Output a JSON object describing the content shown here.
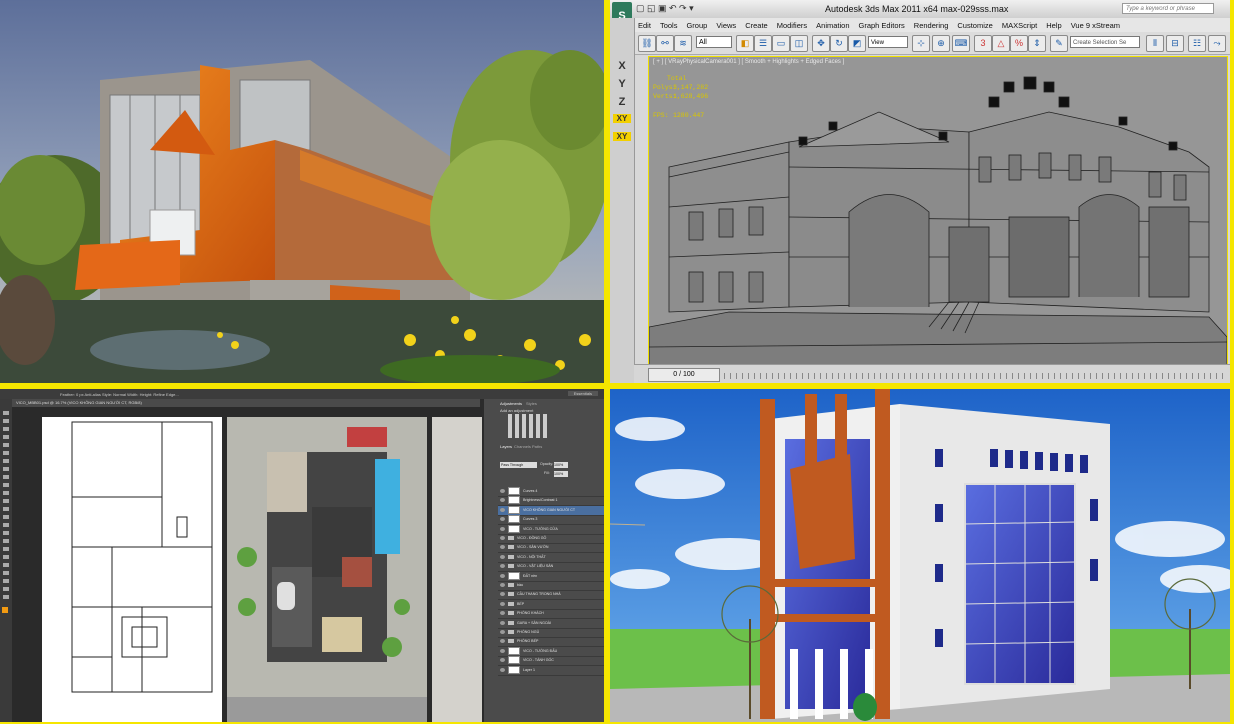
{
  "panel_render_orange": {},
  "max": {
    "window_title": "Autodesk 3ds Max  2011 x64    max-029sss.max",
    "search_placeholder": "Type a keyword or phrase",
    "menu": [
      "Edit",
      "Tools",
      "Group",
      "Views",
      "Create",
      "Modifiers",
      "Animation",
      "Graph Editors",
      "Rendering",
      "Customize",
      "MAXScript",
      "Help",
      "Vue 9 xStream"
    ],
    "selection_filter": "All",
    "ref_coord": "View",
    "named_selection": "Create Selection Se",
    "viewport_label": "[ + ] [ VRayPhysicalCamera001 ] [ Smooth + Highlights + Edged Faces ]",
    "stats": {
      "total_label": "Total",
      "polys_label": "Polys:",
      "polys": "3,147,282",
      "verts_label": "Verts:",
      "verts": "1,628,496",
      "fps_label": "FPS:",
      "fps": "1280.447"
    },
    "axis_labels": [
      "X",
      "Y",
      "Z",
      "XY",
      "XY"
    ],
    "timeline": "0 / 100"
  },
  "ps": {
    "options_bar": "Feather: 0 px   Anti-alias   Style: Normal   Width:   Height:   Refine Edge...",
    "workspace": "Essentials",
    "doc_tab": "VICO_MBB01.psd @ 16.7% (VICO KHÔNG GIAN NGƯỜI CT, RGB/8)",
    "adjustments_tab": "Adjustments",
    "styles_tab": "Styles",
    "add_adjustment": "Add an adjustment",
    "layers_tabs": [
      "Layers",
      "Channels",
      "Paths"
    ],
    "blend_mode": "Pass Through",
    "opacity_label": "Opacity:",
    "opacity": "100%",
    "fill_label": "Fill:",
    "fill": "100%",
    "layers": [
      {
        "name": "Curves 4",
        "type": "adj"
      },
      {
        "name": "Brightness/Contrast 1",
        "type": "adj"
      },
      {
        "name": "VICO KHÔNG GIAN NGƯỜI CT",
        "type": "adj",
        "selected": true
      },
      {
        "name": "Curves 3",
        "type": "adj"
      },
      {
        "name": "VICO - TƯỜNG CỬA",
        "type": "thumb"
      },
      {
        "name": "VICO - ĐỒNG GỖ",
        "type": "folder"
      },
      {
        "name": "VICO - SÂN VƯỜN",
        "type": "folder"
      },
      {
        "name": "VICO - NỘI THẤT",
        "type": "folder"
      },
      {
        "name": "VICO - VẬT LIỆU SÀN",
        "type": "folder"
      },
      {
        "name": "ĐẤT nền",
        "type": "thumb"
      },
      {
        "name": "bầu",
        "type": "folder"
      },
      {
        "name": "CẦU THANG TRONG NHÀ",
        "type": "folder"
      },
      {
        "name": "BẾP",
        "type": "folder"
      },
      {
        "name": "PHÒNG KHÁCH",
        "type": "folder"
      },
      {
        "name": "GARA + SÂN NGOÀI",
        "type": "folder"
      },
      {
        "name": "PHÒNG NGỦ",
        "type": "folder"
      },
      {
        "name": "PHÒNG BẾP",
        "type": "folder"
      },
      {
        "name": "VICO - TƯỜNG ĐẤU",
        "type": "thumb"
      },
      {
        "name": "VICO - TÁNH GỐC",
        "type": "thumb"
      },
      {
        "name": "Layer 1",
        "type": "thumb"
      }
    ]
  },
  "colors": {
    "frame": "#f5e600",
    "max_bg": "#969696",
    "ps_bg": "#2b2b2b",
    "orange": "#e8731a",
    "sky_blue": "#2a7fd6"
  }
}
